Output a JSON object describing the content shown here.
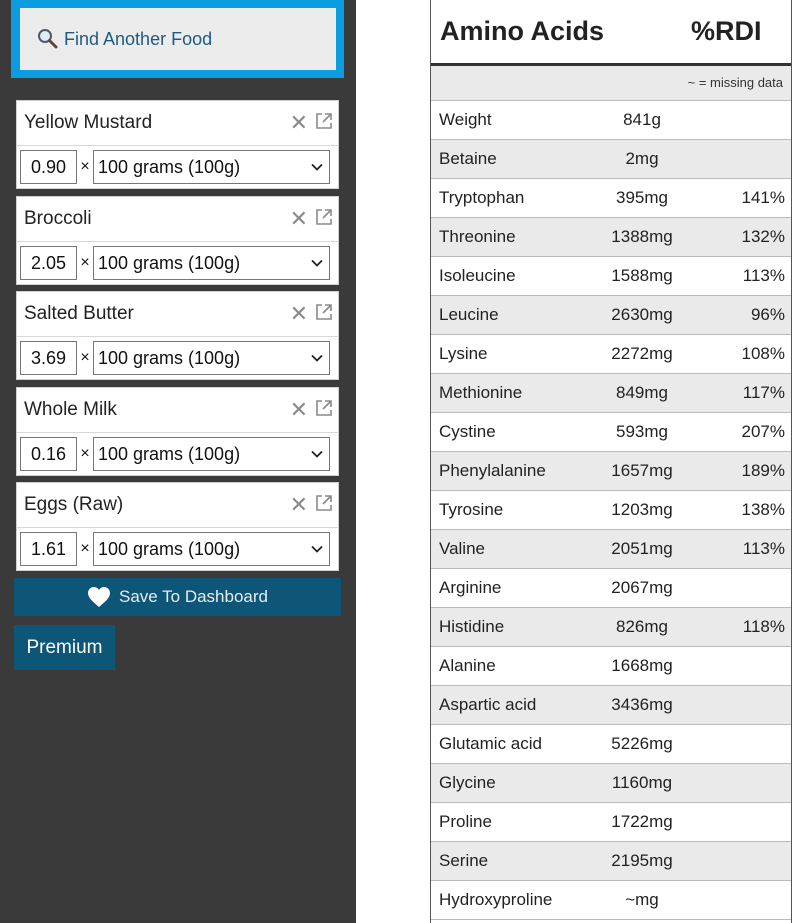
{
  "sidebar": {
    "find_label": "Find Another Food",
    "foods": [
      {
        "name": "Yellow Mustard",
        "qty": "0.90",
        "unit": "100 grams (100g)"
      },
      {
        "name": "Broccoli",
        "qty": "2.05",
        "unit": "100 grams (100g)"
      },
      {
        "name": "Salted Butter",
        "qty": "3.69",
        "unit": "100 grams (100g)"
      },
      {
        "name": "Whole Milk",
        "qty": "0.16",
        "unit": "100 grams (100g)"
      },
      {
        "name": "Eggs (Raw)",
        "qty": "1.61",
        "unit": "100 grams (100g)"
      }
    ],
    "times": "×",
    "save_label": "Save To Dashboard",
    "premium_label": "Premium"
  },
  "panel": {
    "title": "Amino Acids",
    "rdi_header": "%RDI",
    "missing_note": "~ = missing data",
    "rows": [
      {
        "name": "Weight",
        "amount": "841g",
        "rdi": ""
      },
      {
        "name": "Betaine",
        "amount": "2mg",
        "rdi": ""
      },
      {
        "name": "Tryptophan",
        "amount": "395mg",
        "rdi": "141%"
      },
      {
        "name": "Threonine",
        "amount": "1388mg",
        "rdi": "132%"
      },
      {
        "name": "Isoleucine",
        "amount": "1588mg",
        "rdi": "113%"
      },
      {
        "name": "Leucine",
        "amount": "2630mg",
        "rdi": "96%"
      },
      {
        "name": "Lysine",
        "amount": "2272mg",
        "rdi": "108%"
      },
      {
        "name": "Methionine",
        "amount": "849mg",
        "rdi": "117%"
      },
      {
        "name": "Cystine",
        "amount": "593mg",
        "rdi": "207%"
      },
      {
        "name": "Phenylalanine",
        "amount": "1657mg",
        "rdi": "189%"
      },
      {
        "name": "Tyrosine",
        "amount": "1203mg",
        "rdi": "138%"
      },
      {
        "name": "Valine",
        "amount": "2051mg",
        "rdi": "113%"
      },
      {
        "name": "Arginine",
        "amount": "2067mg",
        "rdi": ""
      },
      {
        "name": "Histidine",
        "amount": "826mg",
        "rdi": "118%"
      },
      {
        "name": "Alanine",
        "amount": "1668mg",
        "rdi": ""
      },
      {
        "name": "Aspartic acid",
        "amount": "3436mg",
        "rdi": ""
      },
      {
        "name": "Glutamic acid",
        "amount": "5226mg",
        "rdi": ""
      },
      {
        "name": "Glycine",
        "amount": "1160mg",
        "rdi": ""
      },
      {
        "name": "Proline",
        "amount": "1722mg",
        "rdi": ""
      },
      {
        "name": "Serine",
        "amount": "2195mg",
        "rdi": ""
      },
      {
        "name": "Hydroxyproline",
        "amount": "~mg",
        "rdi": ""
      }
    ]
  },
  "colors": {
    "sidebar_bg": "#3a3a3a",
    "find_border": "#0c9ce0",
    "button_bg": "#0d5677"
  }
}
